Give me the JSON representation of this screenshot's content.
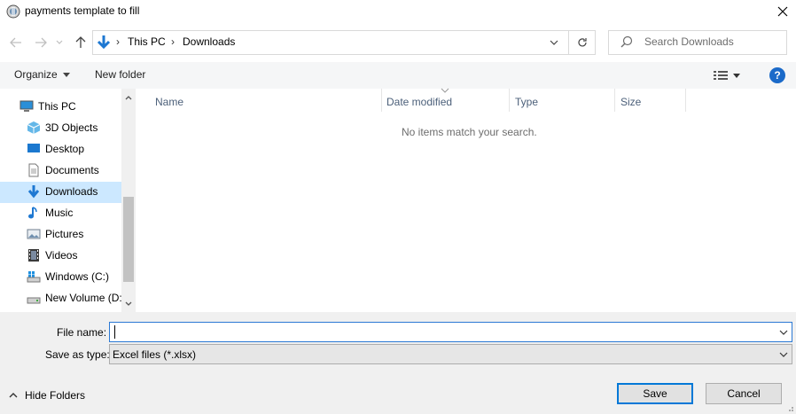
{
  "window": {
    "title": "payments template to fill",
    "icon": "app-icon"
  },
  "address": {
    "breadcrumbs": [
      "This PC",
      "Downloads"
    ],
    "location_icon": "downloads-arrow-icon"
  },
  "search": {
    "placeholder": "Search Downloads"
  },
  "toolbar": {
    "organize_label": "Organize",
    "new_folder_label": "New folder",
    "help_label": "?"
  },
  "sidebar": {
    "items": [
      {
        "label": "This PC",
        "icon": "computer-icon"
      },
      {
        "label": "3D Objects",
        "icon": "3d-objects-icon"
      },
      {
        "label": "Desktop",
        "icon": "desktop-icon"
      },
      {
        "label": "Documents",
        "icon": "documents-icon"
      },
      {
        "label": "Downloads",
        "icon": "downloads-icon",
        "selected": true
      },
      {
        "label": "Music",
        "icon": "music-icon"
      },
      {
        "label": "Pictures",
        "icon": "pictures-icon"
      },
      {
        "label": "Videos",
        "icon": "videos-icon"
      },
      {
        "label": "Windows (C:)",
        "icon": "drive-c-icon"
      },
      {
        "label": "New Volume (D:",
        "icon": "drive-d-icon"
      }
    ]
  },
  "columns": [
    "Name",
    "Date modified",
    "Type",
    "Size"
  ],
  "content": {
    "empty_message": "No items match your search."
  },
  "form": {
    "file_name_label": "File name:",
    "file_name_value": "",
    "save_as_type_label": "Save as type:",
    "save_as_type_value": "Excel files (*.xlsx)"
  },
  "footer": {
    "hide_folders_label": "Hide Folders",
    "save_label": "Save",
    "cancel_label": "Cancel"
  },
  "colors": {
    "accent": "#0078d7",
    "selection": "#cce8ff",
    "help": "#1b6ac9"
  }
}
